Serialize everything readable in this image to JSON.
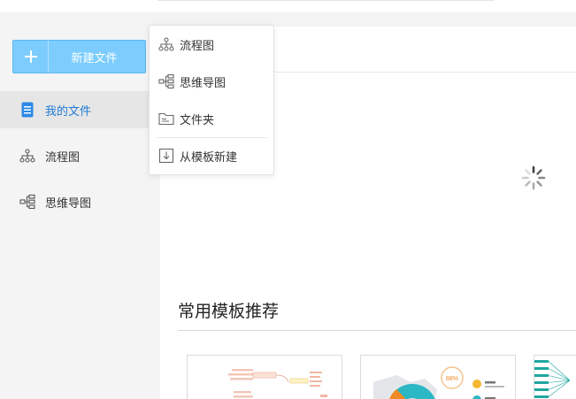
{
  "new_button": {
    "label": "新建文件"
  },
  "sidebar": {
    "items": [
      {
        "label": "我的文件",
        "icon": "document-icon",
        "active": true
      },
      {
        "label": "流程图",
        "icon": "flowchart-icon",
        "active": false
      },
      {
        "label": "思维导图",
        "icon": "mindmap-icon",
        "active": false
      }
    ]
  },
  "dropdown": {
    "items": [
      {
        "label": "流程图",
        "icon": "flowchart-icon"
      },
      {
        "label": "思维导图",
        "icon": "mindmap-icon"
      },
      {
        "label": "文件夹",
        "icon": "folder-icon"
      },
      {
        "label": "从模板新建",
        "icon": "template-import-icon"
      }
    ]
  },
  "templates": {
    "title": "常用模板推荐",
    "cards": [
      {
        "icon": "mindmap-thumbnail"
      },
      {
        "icon": "infographic-thumbnail",
        "badge": "88%"
      },
      {
        "icon": "flow-thumbnail"
      }
    ]
  },
  "colors": {
    "accent": "#7ccdfd",
    "active_text": "#1f7bd6",
    "sidebar_bg": "#f4f4f4",
    "teal": "#2bb7c4",
    "orange": "#f08a24"
  }
}
